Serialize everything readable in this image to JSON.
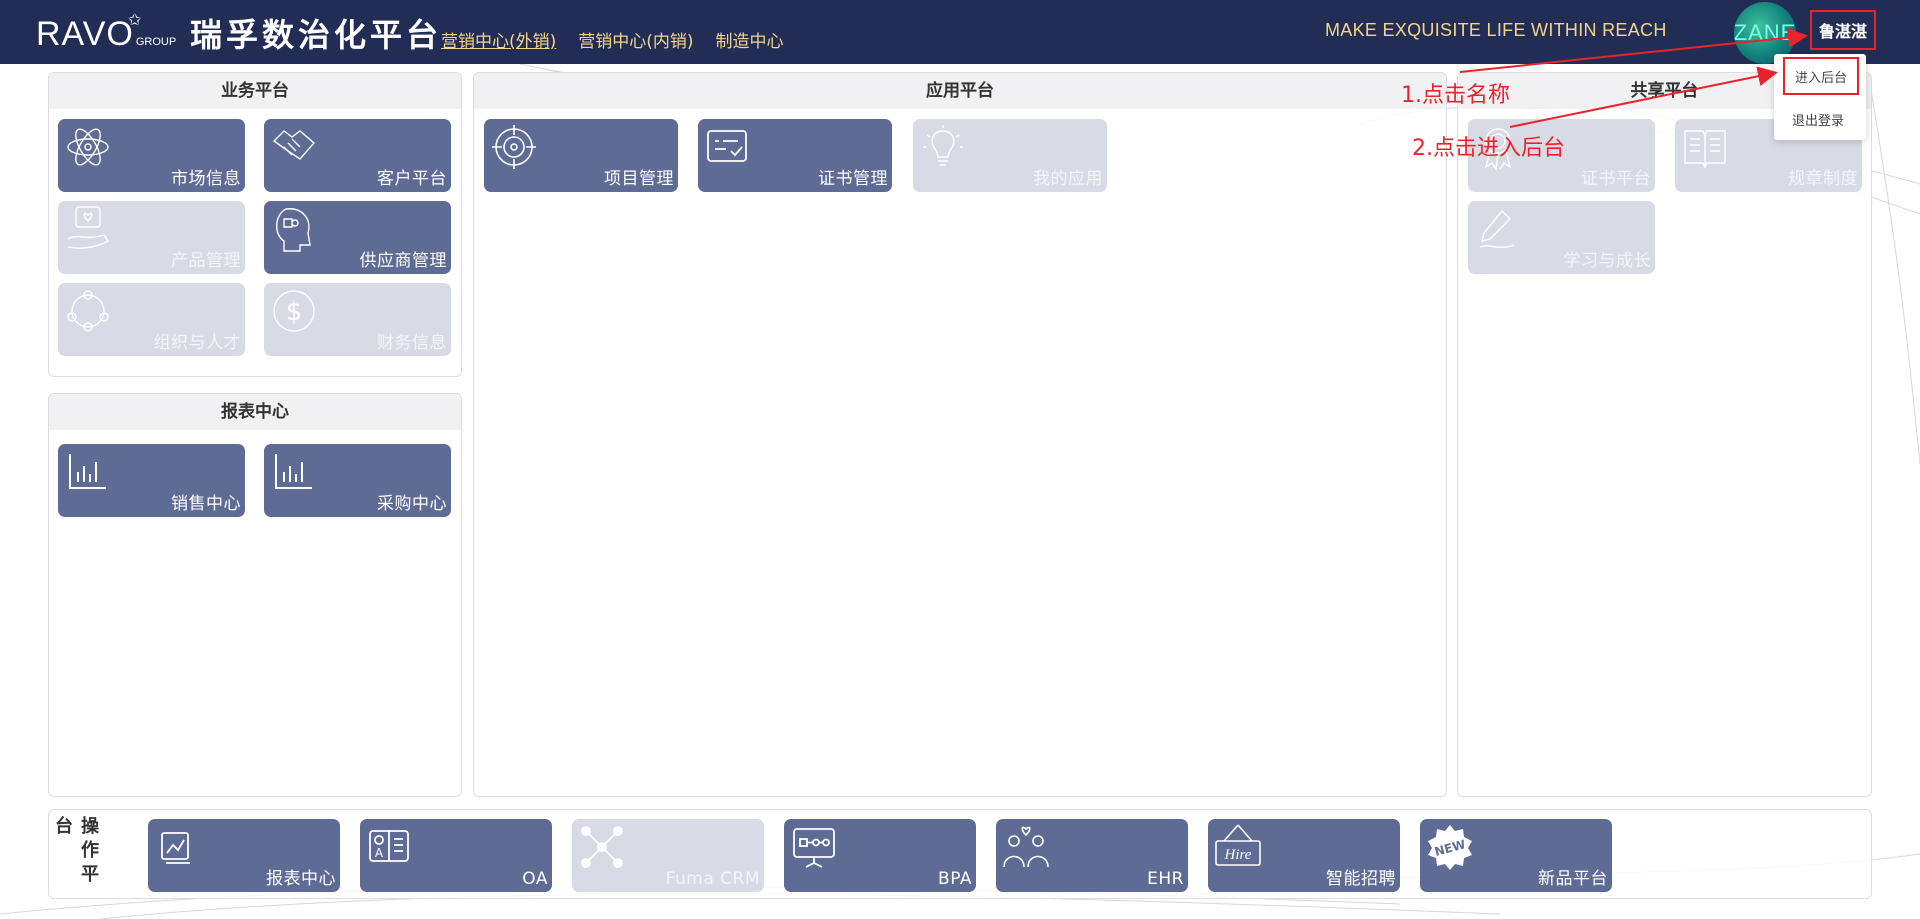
{
  "header": {
    "logo_text": "RAVO",
    "logo_group": "GROUP",
    "platform_title": "瑞孚数治化平台",
    "nav": [
      {
        "label": "营销中心(外销)"
      },
      {
        "label": "营销中心(内销)"
      },
      {
        "label": "制造中心"
      }
    ],
    "slogan": "MAKE EXQUISITE LIFE WITHIN REACH",
    "avatar_text": "ZANE",
    "username": "鲁湛湛"
  },
  "dropdown": {
    "items": [
      {
        "label": "进入后台"
      },
      {
        "label": "退出登录"
      }
    ]
  },
  "business": {
    "title": "业务平台",
    "tiles": [
      {
        "label": "市场信息",
        "icon": "atom-icon",
        "enabled": true
      },
      {
        "label": "客户平台",
        "icon": "handshake-icon",
        "enabled": true
      },
      {
        "label": "产品管理",
        "icon": "hand-heart-icon",
        "enabled": false
      },
      {
        "label": "供应商管理",
        "icon": "puzzle-head-icon",
        "enabled": true
      },
      {
        "label": "组织与人才",
        "icon": "people-circle-icon",
        "enabled": false
      },
      {
        "label": "财务信息",
        "icon": "dollar-icon",
        "enabled": false
      }
    ]
  },
  "reports": {
    "title": "报表中心",
    "tiles": [
      {
        "label": "销售中心",
        "icon": "bar-chart-icon",
        "enabled": true
      },
      {
        "label": "采购中心",
        "icon": "bar-chart-icon",
        "enabled": true
      }
    ]
  },
  "apps": {
    "title": "应用平台",
    "tiles": [
      {
        "label": "项目管理",
        "icon": "target-icon",
        "enabled": true
      },
      {
        "label": "证书管理",
        "icon": "certificate-icon",
        "enabled": true
      },
      {
        "label": "我的应用",
        "icon": "lightbulb-icon",
        "enabled": false
      }
    ]
  },
  "shared": {
    "title": "共享平台",
    "tiles": [
      {
        "label": "证书平台",
        "icon": "ribbon-icon",
        "enabled": false
      },
      {
        "label": "规章制度",
        "icon": "book-icon",
        "enabled": false
      },
      {
        "label": "学习与成长",
        "icon": "pen-icon",
        "enabled": false
      }
    ]
  },
  "operate": {
    "title_chars": [
      "操",
      "作",
      "平",
      "台"
    ],
    "tiles": [
      {
        "label": "报表中心",
        "icon": "report-icon",
        "enabled": true
      },
      {
        "label": "OA",
        "icon": "oa-icon",
        "enabled": true
      },
      {
        "label": "Fuma CRM",
        "icon": "network-icon",
        "enabled": false
      },
      {
        "label": "BPA",
        "icon": "presentation-icon",
        "enabled": true
      },
      {
        "label": "EHR",
        "icon": "people-heart-icon",
        "enabled": true
      },
      {
        "label": "智能招聘",
        "icon": "hire-sign-icon",
        "enabled": true
      },
      {
        "label": "新品平台",
        "icon": "new-badge-icon",
        "enabled": true
      }
    ]
  },
  "annotations": {
    "step1": "1.点击名称",
    "step2": "2.点击进入后台"
  },
  "colors": {
    "header_bg": "#222d56",
    "tile_active": "#5e6b94",
    "tile_disabled": "#d8dbe5",
    "nav_gold": "#f3d58a",
    "annotation_red": "#e8242a"
  }
}
